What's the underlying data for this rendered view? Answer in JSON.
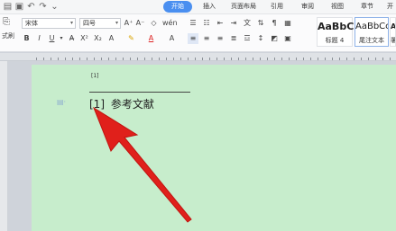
{
  "tabs": [
    {
      "label": "开始",
      "active": true
    },
    {
      "label": "插入",
      "active": false
    },
    {
      "label": "页面布局",
      "active": false
    },
    {
      "label": "引用",
      "active": false
    },
    {
      "label": "审阅",
      "active": false
    },
    {
      "label": "视图",
      "active": false
    },
    {
      "label": "章节",
      "active": false
    },
    {
      "label": "开",
      "active": false
    }
  ],
  "ribbon": {
    "font_name": "宋体",
    "font_size": "四号",
    "format_painter_label": "式刷",
    "styles": [
      {
        "preview": "AaBbC",
        "label": "标题 4"
      },
      {
        "preview": "AaBbCcI",
        "label": "尾注文本"
      },
      {
        "preview": "Aa",
        "label": "署"
      }
    ]
  },
  "document": {
    "footnote_ref": "[1]",
    "endnote_number": "[1]",
    "endnote_text": "参考文献"
  },
  "colors": {
    "accent": "#4a8ff0",
    "page_bg": "#c7edcc",
    "arrow": "#e0201b"
  }
}
